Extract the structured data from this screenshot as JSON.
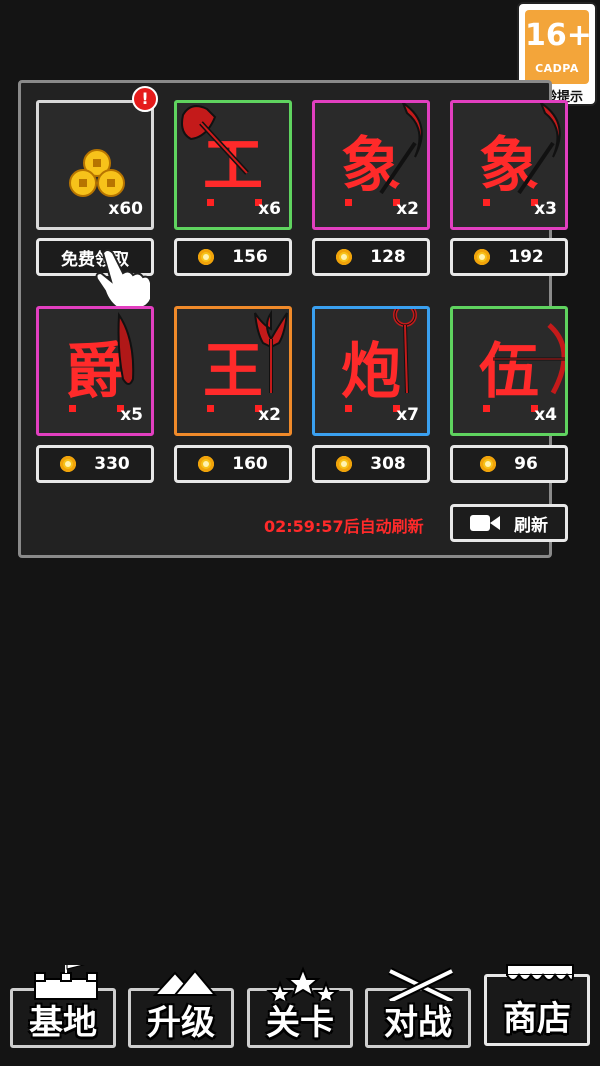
{
  "age_rating": {
    "number": "16+",
    "org": "CADPA",
    "tip": "适龄提示"
  },
  "shop": {
    "cards": [
      {
        "glyph": "",
        "count": "x60",
        "border": "#d9d9d9",
        "price": "",
        "action": "免费领取",
        "weapon": "coins-icon",
        "has_alert": true
      },
      {
        "glyph": "工",
        "count": "x6",
        "border": "#5fd35f",
        "price": "156",
        "weapon": "axe-icon"
      },
      {
        "glyph": "象",
        "count": "x2",
        "border": "#e23fc0",
        "price": "128",
        "weapon": "scythe-icon"
      },
      {
        "glyph": "象",
        "count": "x3",
        "border": "#e23fc0",
        "price": "192",
        "weapon": "scythe-icon"
      },
      {
        "glyph": "爵",
        "count": "x5",
        "border": "#e23fc0",
        "price": "330",
        "weapon": "dagger-icon"
      },
      {
        "glyph": "王",
        "count": "x2",
        "border": "#f08a2a",
        "price": "160",
        "weapon": "trident-icon"
      },
      {
        "glyph": "炮",
        "count": "x7",
        "border": "#3aa0f0",
        "price": "308",
        "weapon": "staff-icon"
      },
      {
        "glyph": "伍",
        "count": "x4",
        "border": "#5fd35f",
        "price": "96",
        "weapon": "bow-icon"
      }
    ],
    "alert_mark": "!",
    "refresh_timer": "02:59:57后自动刷新",
    "refresh_label": "刷新"
  },
  "nav": [
    {
      "label": "基地",
      "icon": "flag-castle-icon"
    },
    {
      "label": "升级",
      "icon": "arrows-up-icon"
    },
    {
      "label": "关卡",
      "icon": "stars-icon"
    },
    {
      "label": "对战",
      "icon": "crossed-swords-icon"
    },
    {
      "label": "商店",
      "icon": "shop-awning-icon",
      "active": true
    }
  ],
  "colors": {
    "accent_red": "#ff2a2a",
    "coin": "#f7c21a",
    "panel_border": "#8a8a8a"
  }
}
